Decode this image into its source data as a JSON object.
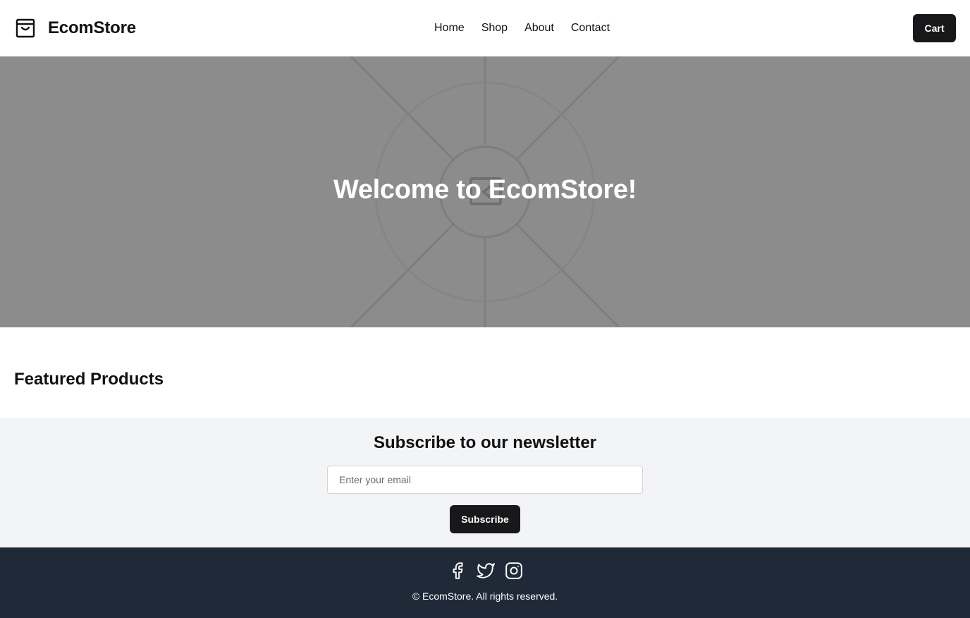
{
  "header": {
    "brand_icon": "shopping-bag-icon",
    "brand_name": "EcomStore",
    "nav": [
      {
        "label": "Home"
      },
      {
        "label": "Shop"
      },
      {
        "label": "About"
      },
      {
        "label": "Contact"
      }
    ],
    "cart_label": "Cart"
  },
  "hero": {
    "title": "Welcome to EcomStore!",
    "background_color": "#8c8c8c",
    "image_icon": "image-placeholder-icon"
  },
  "featured": {
    "title": "Featured Products"
  },
  "newsletter": {
    "title": "Subscribe to our newsletter",
    "email_placeholder": "Enter your email",
    "email_value": "",
    "subscribe_label": "Subscribe"
  },
  "footer": {
    "socials": [
      "facebook-icon",
      "twitter-icon",
      "instagram-icon"
    ],
    "copyright": "© EcomStore. All rights reserved."
  },
  "colors": {
    "primary_button": "#18181b",
    "footer_bg": "#1f2937",
    "newsletter_bg": "#f3f4f6"
  }
}
